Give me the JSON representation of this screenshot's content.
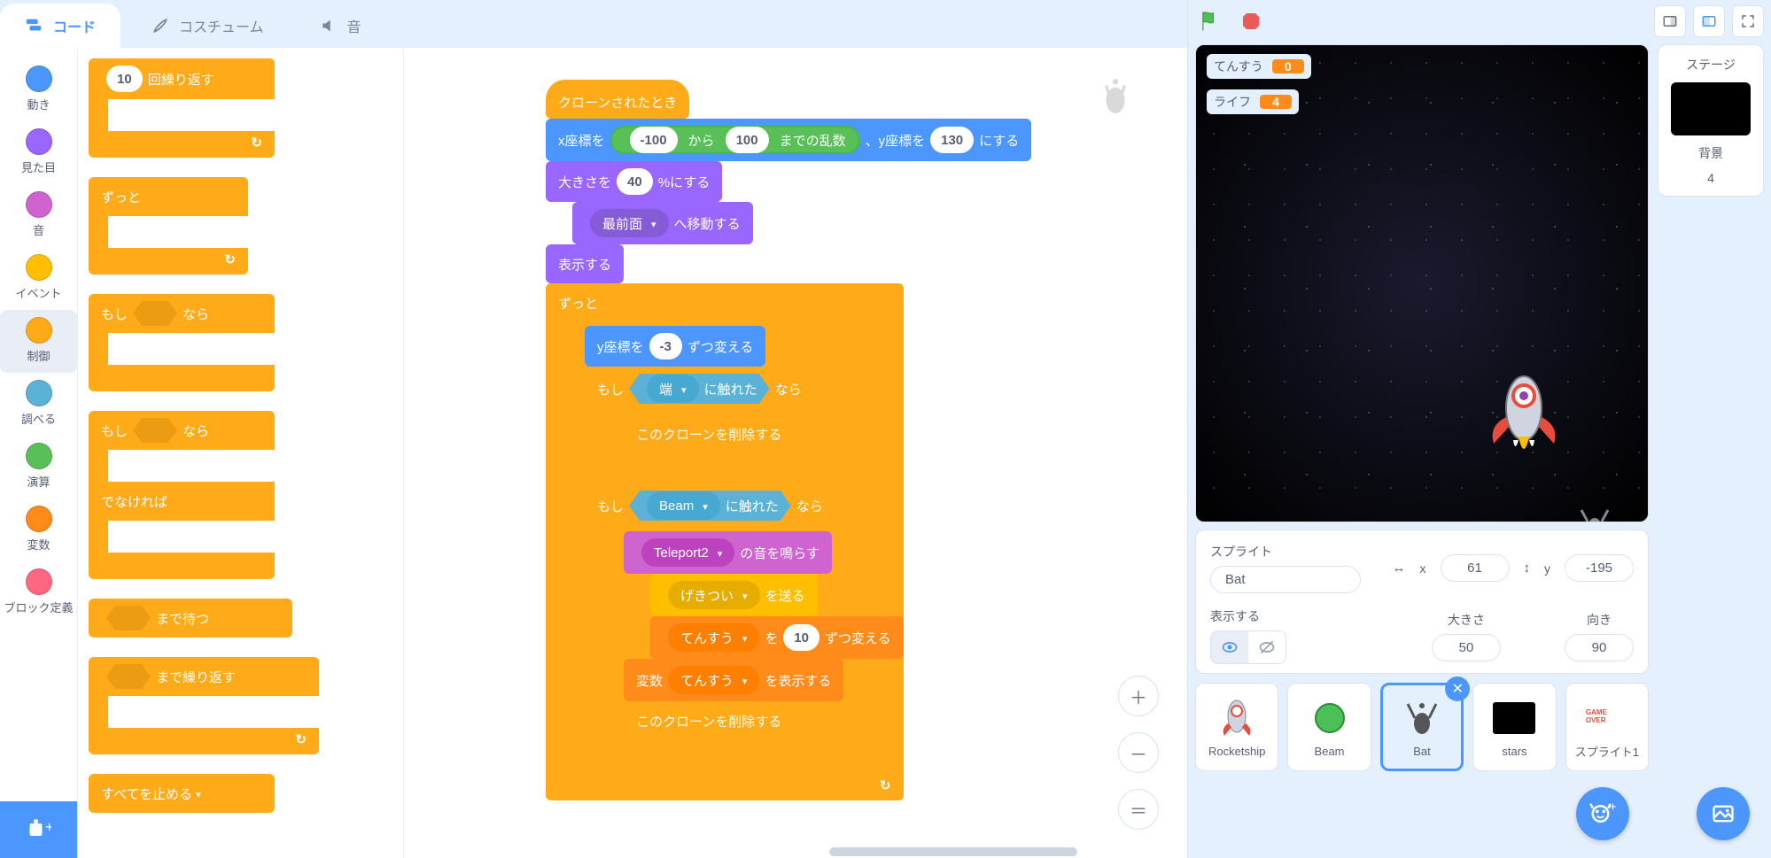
{
  "tabs": {
    "code": "コード",
    "costumes": "コスチューム",
    "sounds": "音"
  },
  "categories": {
    "motion": {
      "label": "動き",
      "color": "#4c97ff"
    },
    "looks": {
      "label": "見た目",
      "color": "#9966ff"
    },
    "sound": {
      "label": "音",
      "color": "#cf63cf"
    },
    "events": {
      "label": "イベント",
      "color": "#ffbf00"
    },
    "control": {
      "label": "制御",
      "color": "#ffab19"
    },
    "sensing": {
      "label": "調べる",
      "color": "#5cb1d6"
    },
    "operators": {
      "label": "演算",
      "color": "#59c059"
    },
    "variables": {
      "label": "変数",
      "color": "#ff8c1a"
    },
    "myblocks": {
      "label": "ブロック定義",
      "color": "#ff6680"
    }
  },
  "palette": {
    "repeat_n": "10",
    "repeat_label": "回繰り返す",
    "forever": "ずっと",
    "if": "もし",
    "then": "なら",
    "else": "でなければ",
    "wait_until": "まで待つ",
    "repeat_until": "まで繰り返す",
    "stop_all": "すべてを止める"
  },
  "script": {
    "hat": "クローンされたとき",
    "goto_pre": "x座標を",
    "rand_from": "-100",
    "rand_mid": "から",
    "rand_to": "100",
    "rand_suf": "までの乱数",
    "goto_mid": "、y座標を",
    "goto_y": "130",
    "goto_suf": "にする",
    "size_pre": "大きさを",
    "size_val": "40",
    "size_suf": "%にする",
    "layer_opt": "最前面",
    "layer_suf": "へ移動する",
    "show": "表示する",
    "forever": "ずっと",
    "changey_pre": "y座標を",
    "changey_val": "-3",
    "changey_suf": "ずつ変える",
    "if": "もし",
    "then": "なら",
    "touch_edge": "端",
    "touch_suf": "に触れた",
    "delete_clone": "このクローンを削除する",
    "touch_beam": "Beam",
    "play_sound": "Teleport2",
    "play_suf": "の音を鳴らす",
    "broadcast": "げきつい",
    "broadcast_suf": "を送る",
    "changevar_var": "てんすう",
    "changevar_mid": "を",
    "changevar_val": "10",
    "changevar_suf": "ずつ変える",
    "showvar_pre": "変数",
    "showvar_var": "てんすう",
    "showvar_suf": "を表示する"
  },
  "stage": {
    "monitors": {
      "score_label": "てんすう",
      "score_val": "0",
      "life_label": "ライフ",
      "life_val": "4"
    }
  },
  "spriteInfo": {
    "title": "スプライト",
    "name": "Bat",
    "x_label": "x",
    "x_val": "61",
    "y_label": "y",
    "y_val": "-195",
    "show_label": "表示する",
    "size_label": "大きさ",
    "size_val": "50",
    "dir_label": "向き",
    "dir_val": "90"
  },
  "sprites": {
    "rocketship": "Rocketship",
    "beam": "Beam",
    "bat": "Bat",
    "stars": "stars",
    "sprite1": "スプライト1",
    "gameover_text": "GAME OVER"
  },
  "stagePanel": {
    "title": "ステージ",
    "backdrops": "背景",
    "count": "4"
  }
}
